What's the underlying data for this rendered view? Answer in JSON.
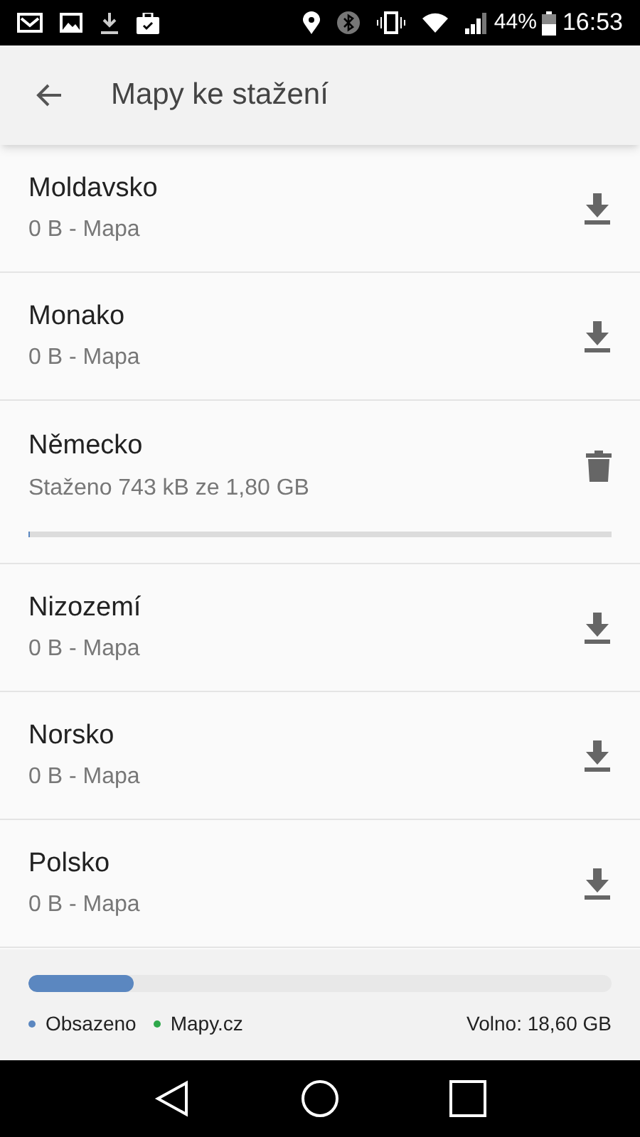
{
  "status_bar": {
    "battery": "44%",
    "time": "16:53"
  },
  "app_bar": {
    "title": "Mapy ke stažení"
  },
  "maps": [
    {
      "name": "Moldavsko",
      "detail": "0 B - Mapa",
      "kind": "available"
    },
    {
      "name": "Monako",
      "detail": "0 B - Mapa",
      "kind": "available"
    },
    {
      "name": "Německo",
      "detail": "Staženo 743 kB ze 1,80 GB",
      "kind": "downloading",
      "level": 0.0004
    },
    {
      "name": "Nizozemí",
      "detail": "0 B - Mapa",
      "kind": "available"
    },
    {
      "name": "Norsko",
      "detail": "0 B - Mapa",
      "kind": "available"
    },
    {
      "name": "Polsko",
      "detail": "0 B - Mapa",
      "kind": "available"
    }
  ],
  "storage": {
    "level": 0.18,
    "legend": [
      {
        "label": "Obsazeno",
        "color": "#5b87c0"
      },
      {
        "label": "Mapy.cz",
        "color": "#2ea84a"
      }
    ],
    "free": "Volno: 18,60 GB"
  }
}
